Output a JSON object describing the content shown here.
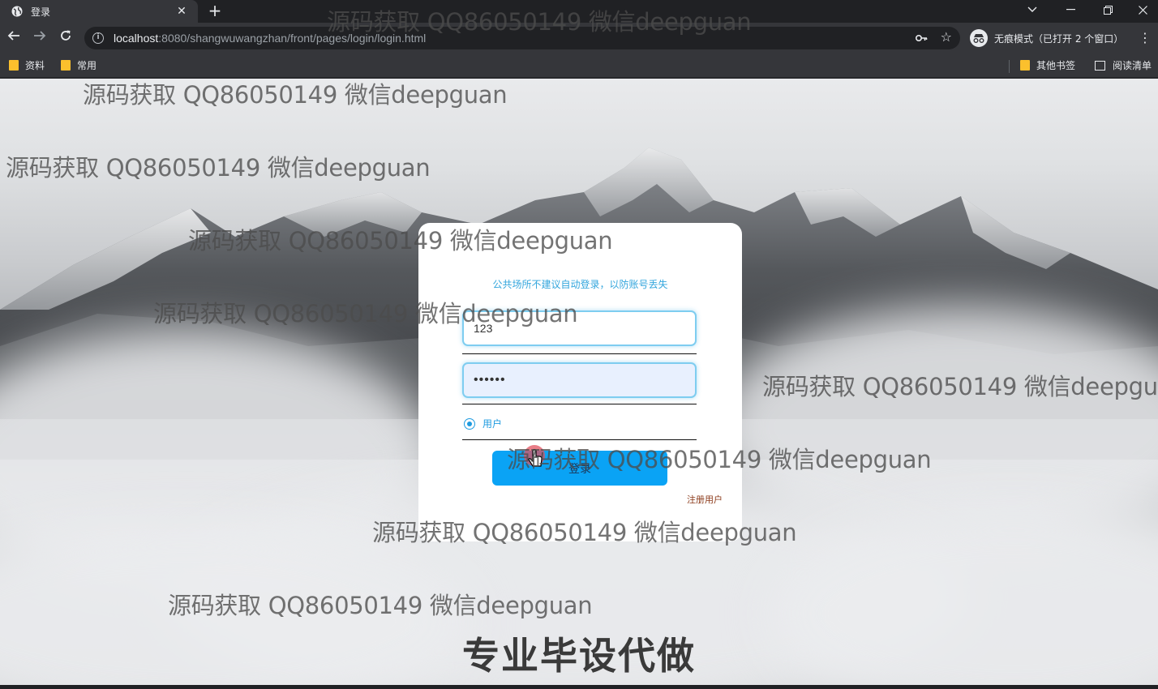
{
  "browser": {
    "tab_title": "登录",
    "new_tab": "+",
    "tab_close": "✕",
    "url_host": "localhost",
    "url_rest": ":8080/shangwuwangzhan/front/pages/login/login.html",
    "incognito_label": "无痕模式（已打开 2 个窗口）",
    "bookmarks": [
      "资料",
      "常用"
    ],
    "other_bookmarks": "其他书签",
    "reading_list": "阅读清单"
  },
  "login": {
    "notice": "公共场所不建议自动登录，以防账号丢失",
    "username_value": "123",
    "password_mask": "••••••",
    "role_label": "用户",
    "login_button": "登录",
    "register_link": "注册用户"
  },
  "watermarks": [
    "源码获取 QQ86050149 微信deepguan",
    "源码获取 QQ86050149 微信deepguan",
    "源码获取 QQ86050149 微信deepguan",
    "源码获取 QQ86050149 微信deepguan",
    "源码获取 QQ86050149 微信deepguan",
    "源码获取 QQ86050149 微信deepgu",
    "源码获取 QQ86050149 微信deepguan",
    "源码获取 QQ86050149 微信deepguan",
    "源码获取 QQ86050149 微信deepguan"
  ],
  "overlay_ad": "专业毕设代做"
}
